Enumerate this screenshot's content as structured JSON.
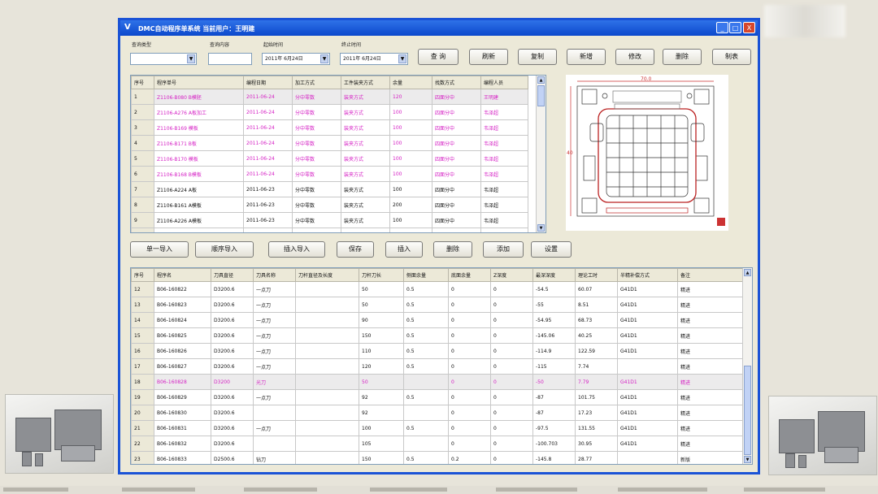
{
  "window": {
    "title": "DMC自动程序单系统  当前用户：王明建",
    "icon_text": "V",
    "controls": {
      "minimize": "_",
      "maximize": "□",
      "close": "X"
    }
  },
  "filters": {
    "query_type_label": "查询类型",
    "query_type_value": "",
    "query_content_label": "查询内容",
    "query_content_value": "",
    "start_time_label": "起始时间",
    "start_time_value": "2011年 6月24日",
    "end_time_label": "终止时间",
    "end_time_value": "2011年 6月24日"
  },
  "toolbar_top": [
    "查 询",
    "刷新",
    "复制",
    "新增",
    "修改",
    "删除",
    "制表"
  ],
  "top_grid": {
    "headers": [
      "序号",
      "程序单号",
      "编程日期",
      "加工方式",
      "工件装夹方式",
      "余量",
      "找数方式",
      "编程人员"
    ],
    "rows": [
      [
        "1",
        "Z1106-B080 B模胚",
        "2011-06-24",
        "分中零数",
        "装夹方式",
        "120",
        "四面分中",
        "王明建"
      ],
      [
        "2",
        "Z1106-A276 A板加工",
        "2011-06-24",
        "分中零数",
        "装夹方式",
        "100",
        "四面分中",
        "韦泽超"
      ],
      [
        "3",
        "Z1106-B169 模板",
        "2011-06-24",
        "分中零数",
        "装夹方式",
        "100",
        "四面分中",
        "韦泽超"
      ],
      [
        "4",
        "Z1106-B171 B板",
        "2011-06-24",
        "分中零数",
        "装夹方式",
        "100",
        "四面分中",
        "韦泽超"
      ],
      [
        "5",
        "Z1106-B170 模板",
        "2011-06-24",
        "分中零数",
        "装夹方式",
        "100",
        "四面分中",
        "韦泽超"
      ],
      [
        "6",
        "Z1106-B168 B模板",
        "2011-06-24",
        "分中零数",
        "装夹方式",
        "100",
        "四面分中",
        "韦泽超"
      ],
      [
        "7",
        "Z1106-A224 A板",
        "2011-06-23",
        "分中零数",
        "装夹方式",
        "100",
        "四面分中",
        "韦泽超"
      ],
      [
        "8",
        "Z1106-B161 A模板",
        "2011-06-23",
        "分中零数",
        "装夹方式",
        "200",
        "四面分中",
        "韦泽超"
      ],
      [
        "9",
        "Z1106-A226 A模板",
        "2011-06-23",
        "分中零数",
        "装夹方式",
        "100",
        "四面分中",
        "韦泽超"
      ],
      [
        "10",
        "A05-211A 模板",
        "2011-06-23",
        "分中零数",
        "装夹方式",
        "604.55",
        "四面分中",
        "韦泽超"
      ]
    ],
    "pink_rows": [
      0,
      1,
      2,
      3,
      4,
      5
    ],
    "selected_row": 0
  },
  "toolbar_mid": [
    "单一导入",
    "顺序导入",
    "插入导入",
    "保存",
    "插入",
    "删除",
    "添加",
    "设置"
  ],
  "bottom_grid": {
    "headers": [
      "序号",
      "程序名",
      "刀具直径",
      "刀具名称",
      "刀杆直径及长度",
      "刀杆刀长",
      "侧面余量",
      "底面余量",
      "Z深度",
      "最深深度",
      "理论工时",
      "半精补偿方式",
      "备注"
    ],
    "rows": [
      [
        "12",
        "B06-160822",
        "D3200.6",
        "一点刀",
        "",
        "50",
        "0.5",
        "0",
        "0",
        "-54.5",
        "60.07",
        "G41D1",
        "精进"
      ],
      [
        "13",
        "B06-160823",
        "D3200.6",
        "一点刀",
        "",
        "50",
        "0.5",
        "0",
        "0",
        "-55",
        "8.51",
        "G41D1",
        "精进"
      ],
      [
        "14",
        "B06-160824",
        "D3200.6",
        "一点刀",
        "",
        "90",
        "0.5",
        "0",
        "0",
        "-54.95",
        "68.73",
        "G41D1",
        "精进"
      ],
      [
        "15",
        "B06-160825",
        "D3200.6",
        "一点刀",
        "",
        "150",
        "0.5",
        "0",
        "0",
        "-145.06",
        "40.25",
        "G41D1",
        "精进"
      ],
      [
        "16",
        "B06-160826",
        "D3200.6",
        "一点刀",
        "",
        "110",
        "0.5",
        "0",
        "0",
        "-114.9",
        "122.59",
        "G41D1",
        "精进"
      ],
      [
        "17",
        "B06-160827",
        "D3200.6",
        "一点刀",
        "",
        "120",
        "0.5",
        "0",
        "0",
        "-115",
        "7.74",
        "",
        "精进"
      ],
      [
        "18",
        "B06-160828",
        "D3200",
        "光刀",
        "",
        "50",
        "",
        "0",
        "0",
        "-50",
        "7.79",
        "G41D1",
        "精进"
      ],
      [
        "19",
        "B06-160829",
        "D3200.6",
        "一点刀",
        "",
        "92",
        "0.5",
        "0",
        "0",
        "-87",
        "101.75",
        "G41D1",
        "精进"
      ],
      [
        "20",
        "B06-160830",
        "D3200.6",
        "",
        "",
        "92",
        "",
        "0",
        "0",
        "-87",
        "17.23",
        "G41D1",
        "精进"
      ],
      [
        "21",
        "B06-160831",
        "D3200.6",
        "一点刀",
        "",
        "100",
        "0.5",
        "0",
        "0",
        "-97.5",
        "131.55",
        "G41D1",
        "精进"
      ],
      [
        "22",
        "B06-160832",
        "D3200.6",
        "",
        "",
        "105",
        "",
        "0",
        "0",
        "-100.703",
        "30.95",
        "G41D1",
        "精进"
      ],
      [
        "23",
        "B06-160833",
        "D2500.6",
        "钻刀",
        "",
        "150",
        "0.5",
        "0.2",
        "0",
        "-145.8",
        "28.77",
        "",
        "新版"
      ]
    ],
    "pink_rows": [
      6
    ],
    "selected_row": 6
  },
  "drawing": {
    "label_width": "70.0",
    "label_height": "40"
  }
}
